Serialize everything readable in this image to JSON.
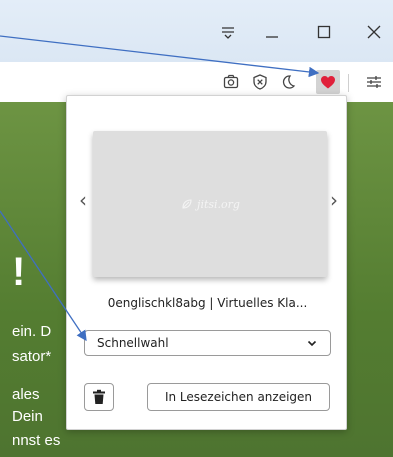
{
  "window": {
    "menu_icon": "menu-lines-icon",
    "minimize_icon": "minimize-icon",
    "maximize_icon": "maximize-icon",
    "close_icon": "close-icon"
  },
  "toolbar": {
    "icons": [
      "camera-icon",
      "shield-x-icon",
      "moon-icon",
      "heart-icon",
      "sliders-icon"
    ],
    "heart_color": "#e0203a"
  },
  "background_page": {
    "big_text": "!",
    "lines": [
      "ein. D",
      "sator*",
      "ales",
      "Dein",
      "nnst es"
    ]
  },
  "popup": {
    "thumbnail_logo": "jitsi.org",
    "prev_arrow": "‹",
    "next_arrow": "›",
    "item_title": "0englischkl8abg | Virtuelles Kla...",
    "select": {
      "selected": "Schnellwahl"
    },
    "delete_icon": "trash-icon",
    "show_bookmarks_label": "In Lesezeichen anzeigen"
  },
  "colors": {
    "titlebar": "#dfe9f6",
    "page_green": "#5f8a3a",
    "annotation_arrow": "#3f6fc2"
  }
}
